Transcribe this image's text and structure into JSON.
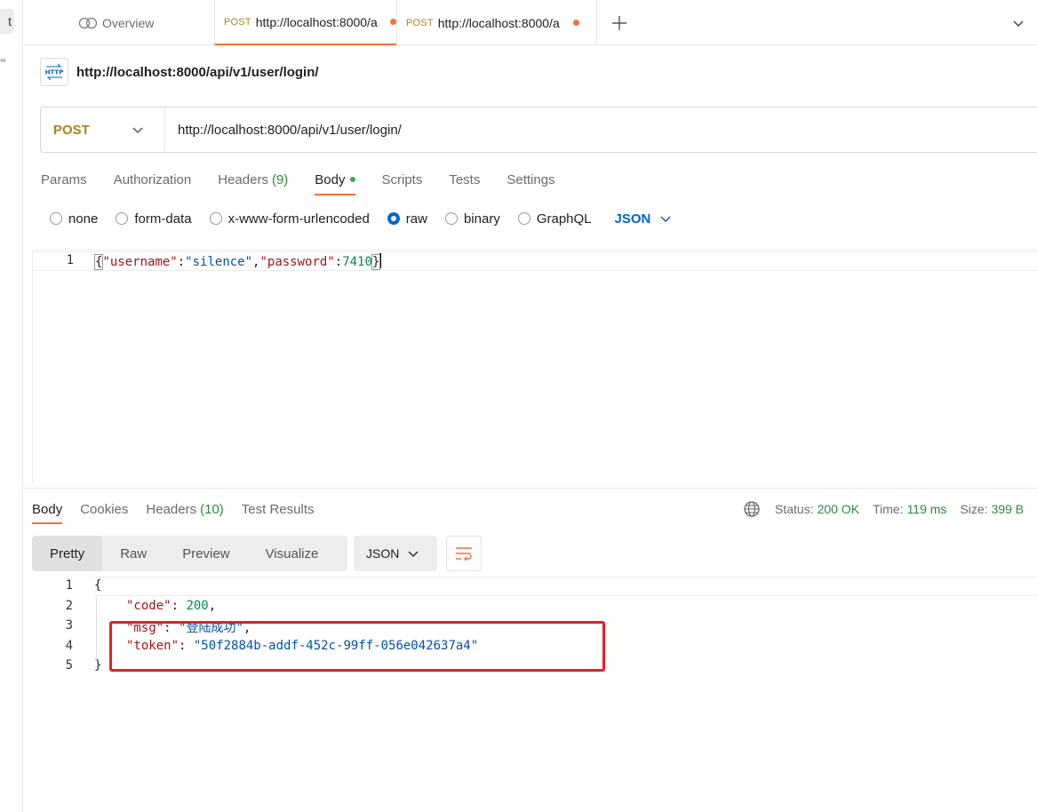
{
  "left_strip": {
    "top_char": "t",
    "dots": "°°"
  },
  "tabs": {
    "overview_label": "Overview",
    "items": [
      {
        "method": "POST",
        "url": "http://localhost:8000/a"
      },
      {
        "method": "POST",
        "url": "http://localhost:8000/a"
      }
    ]
  },
  "request": {
    "title": "http://localhost:8000/api/v1/user/login/",
    "method": "POST",
    "url": "http://localhost:8000/api/v1/user/login/",
    "tabs": [
      {
        "label": "Params"
      },
      {
        "label": "Authorization"
      },
      {
        "label": "Headers",
        "count": "(9)"
      },
      {
        "label": "Body"
      },
      {
        "label": "Scripts"
      },
      {
        "label": "Tests"
      },
      {
        "label": "Settings"
      }
    ],
    "body_types": [
      "none",
      "form-data",
      "x-www-form-urlencoded",
      "raw",
      "binary",
      "GraphQL"
    ],
    "selected_body_type": "raw",
    "body_language": "JSON",
    "body_line_number": "1",
    "body": {
      "open": "{",
      "k1": "\"username\"",
      "colon": ":",
      "v1": "\"silence\"",
      "comma": ",",
      "k2": "\"password\"",
      "v2": "7410",
      "close": "}"
    }
  },
  "response": {
    "tabs": [
      {
        "label": "Body"
      },
      {
        "label": "Cookies"
      },
      {
        "label": "Headers",
        "count": "(10)"
      },
      {
        "label": "Test Results"
      }
    ],
    "status_label": "Status:",
    "status_value": "200 OK",
    "time_label": "Time:",
    "time_value": "119 ms",
    "size_label": "Size:",
    "size_value": "399 B",
    "views": [
      "Pretty",
      "Raw",
      "Preview",
      "Visualize"
    ],
    "format": "JSON",
    "line_numbers": [
      "1",
      "2",
      "3",
      "4",
      "5"
    ],
    "lines": {
      "open": "{",
      "code_key": "\"code\"",
      "code_val": "200",
      "msg_key": "\"msg\"",
      "msg_val": "\"登陆成功\"",
      "token_key": "\"token\"",
      "token_val": "\"50f2884b-addf-452c-99ff-056e042637a4\"",
      "close": "}"
    }
  },
  "colors": {
    "accent": "#ff6c37",
    "method": "#a9861b",
    "success": "#2b8a3e",
    "link": "#0265d2",
    "highlight": "#ee1c25"
  }
}
